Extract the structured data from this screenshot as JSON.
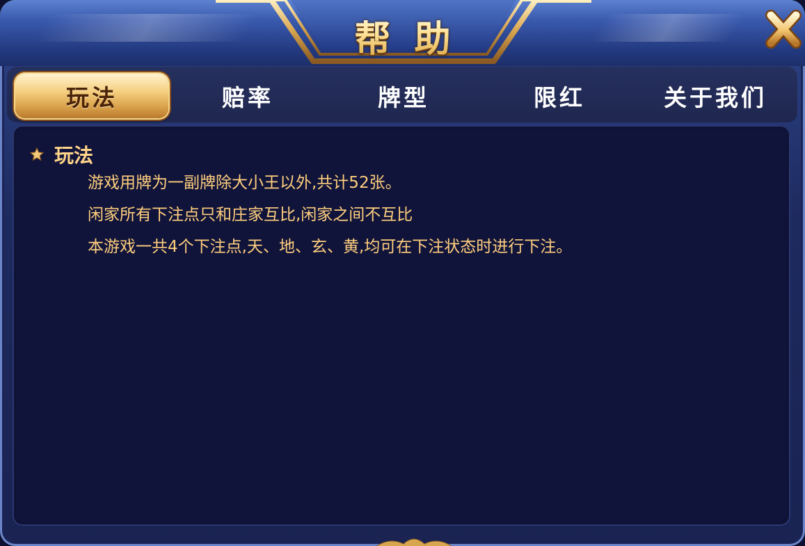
{
  "dialog": {
    "title": "帮助"
  },
  "tabs": [
    {
      "label": "玩法",
      "active": true
    },
    {
      "label": "赔率",
      "active": false
    },
    {
      "label": "牌型",
      "active": false
    },
    {
      "label": "限红",
      "active": false
    },
    {
      "label": "关于我们",
      "active": false
    }
  ],
  "content": {
    "section_title": "玩法",
    "lines": [
      "游戏用牌为一副牌除大小王以外,共计52张。",
      "闲家所有下注点只和庄家互比,闲家之间不互比",
      "本游戏一共4个下注点,天、地、玄、黄,均可在下注状态时进行下注。"
    ]
  },
  "icons": {
    "close": "close-icon",
    "star": "star-icon"
  },
  "colors": {
    "accent_gold": "#f5cf7f",
    "text_gold": "#ffcf7e",
    "panel_bg": "#11143a",
    "frame_blue": "#2a3f82"
  }
}
